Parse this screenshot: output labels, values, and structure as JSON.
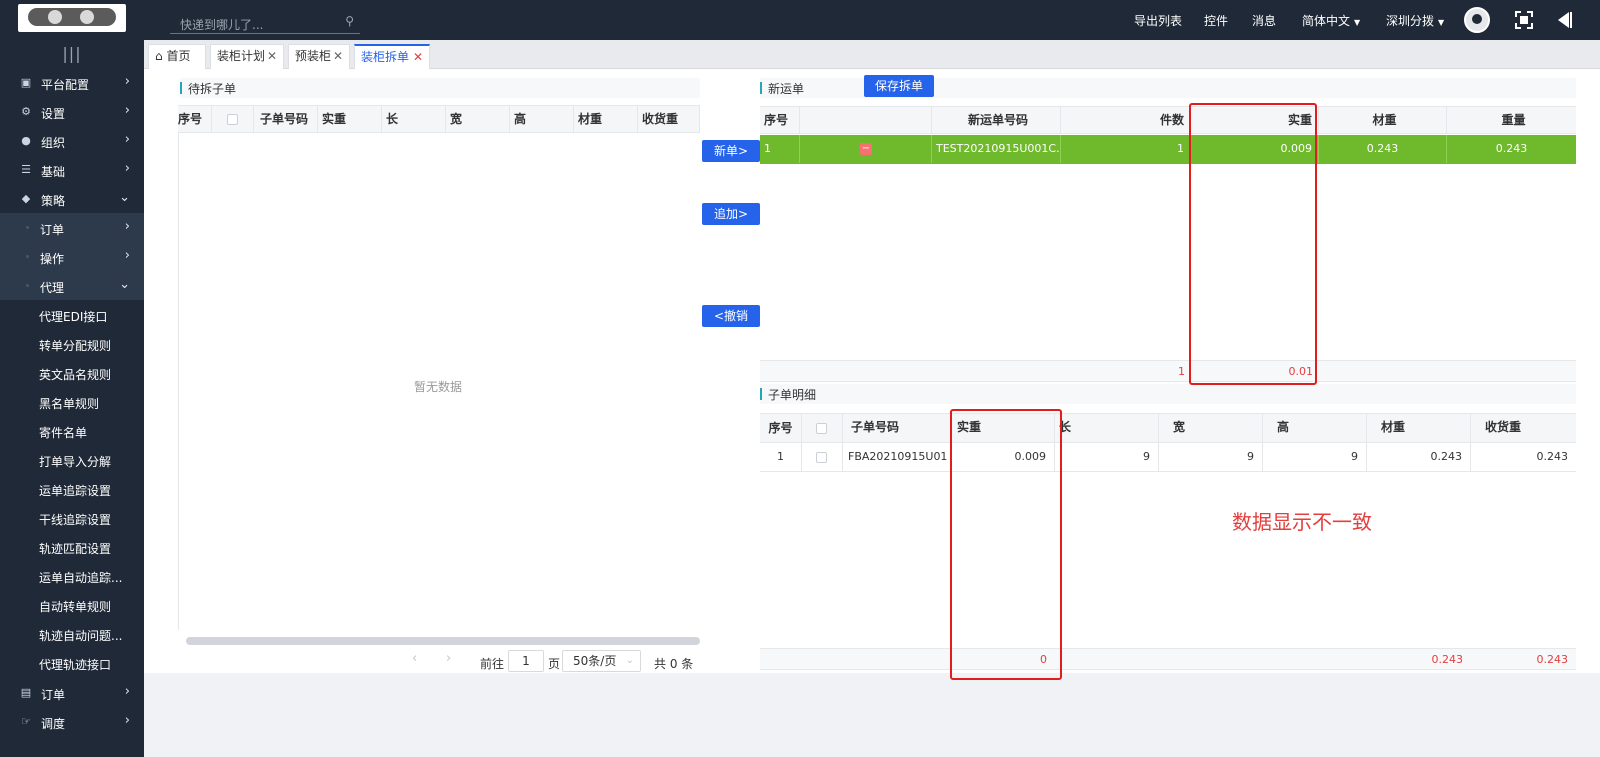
{
  "header": {
    "search_placeholder": "快递到哪儿了...",
    "nav": [
      "导出列表",
      "控件",
      "消息",
      "简体中文",
      "深圳分拨"
    ]
  },
  "sidebar": {
    "toggle": "|||",
    "items": [
      {
        "label": "平台配置",
        "icon": "monitor-icon"
      },
      {
        "label": "设置",
        "icon": "gear-icon"
      },
      {
        "label": "组织",
        "icon": "users-icon"
      },
      {
        "label": "基础",
        "icon": "layers-icon"
      },
      {
        "label": "策略",
        "icon": "shield-icon"
      },
      {
        "label": "订单"
      },
      {
        "label": "操作"
      },
      {
        "label": "代理"
      },
      {
        "label": "代理EDI接口"
      },
      {
        "label": "转单分配规则"
      },
      {
        "label": "英文品名规则"
      },
      {
        "label": "黑名单规则"
      },
      {
        "label": "寄件名单"
      },
      {
        "label": "打单导入分解"
      },
      {
        "label": "运单追踪设置"
      },
      {
        "label": "干线追踪设置"
      },
      {
        "label": "轨迹匹配设置"
      },
      {
        "label": "运单自动追踪..."
      },
      {
        "label": "自动转单规则"
      },
      {
        "label": "轨迹自动问题..."
      },
      {
        "label": "代理轨迹接口"
      },
      {
        "label": "订单",
        "icon": "server-icon"
      },
      {
        "label": "调度",
        "icon": "hand-icon"
      }
    ]
  },
  "tabs": [
    "首页",
    "装柜计划",
    "预装柜",
    "装柜拆单"
  ],
  "left_panel": {
    "title": "待拆子单",
    "columns": [
      "序号",
      "",
      "子单号码",
      "实重",
      "长",
      "宽",
      "高",
      "材重",
      "收货重"
    ],
    "empty_text": "暂无数据",
    "pager": {
      "goto": "前往",
      "page": "1",
      "page_unit": "页",
      "page_size": "50条/页",
      "total": "共 0 条"
    }
  },
  "middle_buttons": [
    "新单>",
    "追加>",
    "<撤销"
  ],
  "new_order": {
    "title": "新运单",
    "save_button": "保存拆单",
    "columns": [
      "序号",
      "",
      "新运单号码",
      "件数",
      "实重",
      "材重",
      "重量"
    ],
    "rows": [
      {
        "index": "1",
        "number": "TEST20210915U001C...",
        "count": "1",
        "actual_weight": "0.009",
        "vol_weight": "0.243",
        "weight": "0.243"
      }
    ],
    "footer": {
      "count": "1",
      "actual_weight": "0.01"
    }
  },
  "detail": {
    "title": "子单明细",
    "columns": [
      "序号",
      "",
      "子单号码",
      "实重",
      "长",
      "宽",
      "高",
      "材重",
      "收货重"
    ],
    "rows": [
      {
        "index": "1",
        "number": "FBA20210915U01",
        "actual_weight": "0.009",
        "length": "9",
        "width": "9",
        "height": "9",
        "vol_weight": "0.243",
        "recv_weight": "0.243"
      }
    ],
    "footer": {
      "actual_weight": "0",
      "vol_weight": "0.243",
      "recv_weight": "0.243"
    }
  },
  "annotation": "数据显示不一致",
  "colors": {
    "topbar": "#1f2937",
    "accent": "#2563eb",
    "row_selected": "#6fb92c",
    "annotation": "#e11d1d"
  }
}
